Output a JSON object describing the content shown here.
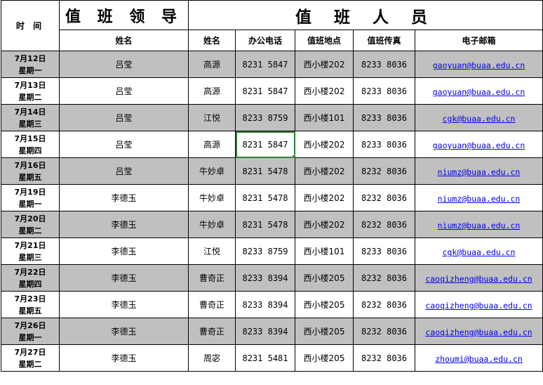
{
  "header": {
    "time_label": "时 间",
    "leader_title": "值 班 领 导",
    "staff_title": "值 班 人 员"
  },
  "columns": {
    "leader_name": "姓名",
    "staff_name": "姓名",
    "office_phone": "办公电话",
    "location": "值班地点",
    "fax": "值班传真",
    "email": "电子邮箱"
  },
  "rows": [
    {
      "date": "7月12日",
      "weekday": "星期一",
      "leader": "吕莹",
      "staff": "高源",
      "phone": "8231 5847",
      "location": "西小楼202",
      "fax": "8233 8036",
      "email": "gaoyuan@buaa.edu.cn"
    },
    {
      "date": "7月13日",
      "weekday": "星期二",
      "leader": "吕莹",
      "staff": "高源",
      "phone": "8231 5847",
      "location": "西小楼202",
      "fax": "8233 8036",
      "email": "gaoyuan@buaa.edu.cn"
    },
    {
      "date": "7月14日",
      "weekday": "星期三",
      "leader": "吕莹",
      "staff": "江悦",
      "phone": "8233 8759",
      "location": "西小楼101",
      "fax": "8233 8036",
      "email": "cgk@buaa.edu.cn"
    },
    {
      "date": "7月15日",
      "weekday": "星期四",
      "leader": "吕莹",
      "staff": "高源",
      "phone": "8231 5847",
      "location": "西小楼202",
      "fax": "8233 8036",
      "email": "gaoyuan@buaa.edu.cn"
    },
    {
      "date": "7月16日",
      "weekday": "星期五",
      "leader": "吕莹",
      "staff": "牛妙卓",
      "phone": "8231 5478",
      "location": "西小楼202",
      "fax": "8232 8036",
      "email": "niumz@buaa.edu.cn"
    },
    {
      "date": "7月19日",
      "weekday": "星期一",
      "leader": "李德玉",
      "staff": "牛妙卓",
      "phone": "8231 5478",
      "location": "西小楼202",
      "fax": "8232 8036",
      "email": "niumz@buaa.edu.cn"
    },
    {
      "date": "7月20日",
      "weekday": "星期二",
      "leader": "李德玉",
      "staff": "牛妙卓",
      "phone": "8231 5478",
      "location": "西小楼202",
      "fax": "8232 8036",
      "email": "niumz@buaa.edu.cn"
    },
    {
      "date": "7月21日",
      "weekday": "星期三",
      "leader": "李德玉",
      "staff": "江悦",
      "phone": "8233 8759",
      "location": "西小楼101",
      "fax": "8233 8036",
      "email": "cgk@buaa.edu.cn"
    },
    {
      "date": "7月22日",
      "weekday": "星期四",
      "leader": "李德玉",
      "staff": "曹奇正",
      "phone": "8233 8394",
      "location": "西小楼205",
      "fax": "8232 8036",
      "email": "caoqizheng@buaa.edu.cn"
    },
    {
      "date": "7月23日",
      "weekday": "星期五",
      "leader": "李德玉",
      "staff": "曹奇正",
      "phone": "8233 8394",
      "location": "西小楼205",
      "fax": "8232 8036",
      "email": "caoqizheng@buaa.edu.cn"
    },
    {
      "date": "7月26日",
      "weekday": "星期一",
      "leader": "李德玉",
      "staff": "曹奇正",
      "phone": "8233 8394",
      "location": "西小楼205",
      "fax": "8232 8036",
      "email": "caoqizheng@buaa.edu.cn"
    },
    {
      "date": "7月27日",
      "weekday": "星期二",
      "leader": "李德玉",
      "staff": "周宓",
      "phone": "8231 5481",
      "location": "西小楼205",
      "fax": "8232 8036",
      "email": "zhoumi@buaa.edu.cn"
    }
  ],
  "colors": {
    "shaded_row": "#c0c0c0",
    "selection": "#2e7d32",
    "link": "#0000ee"
  }
}
